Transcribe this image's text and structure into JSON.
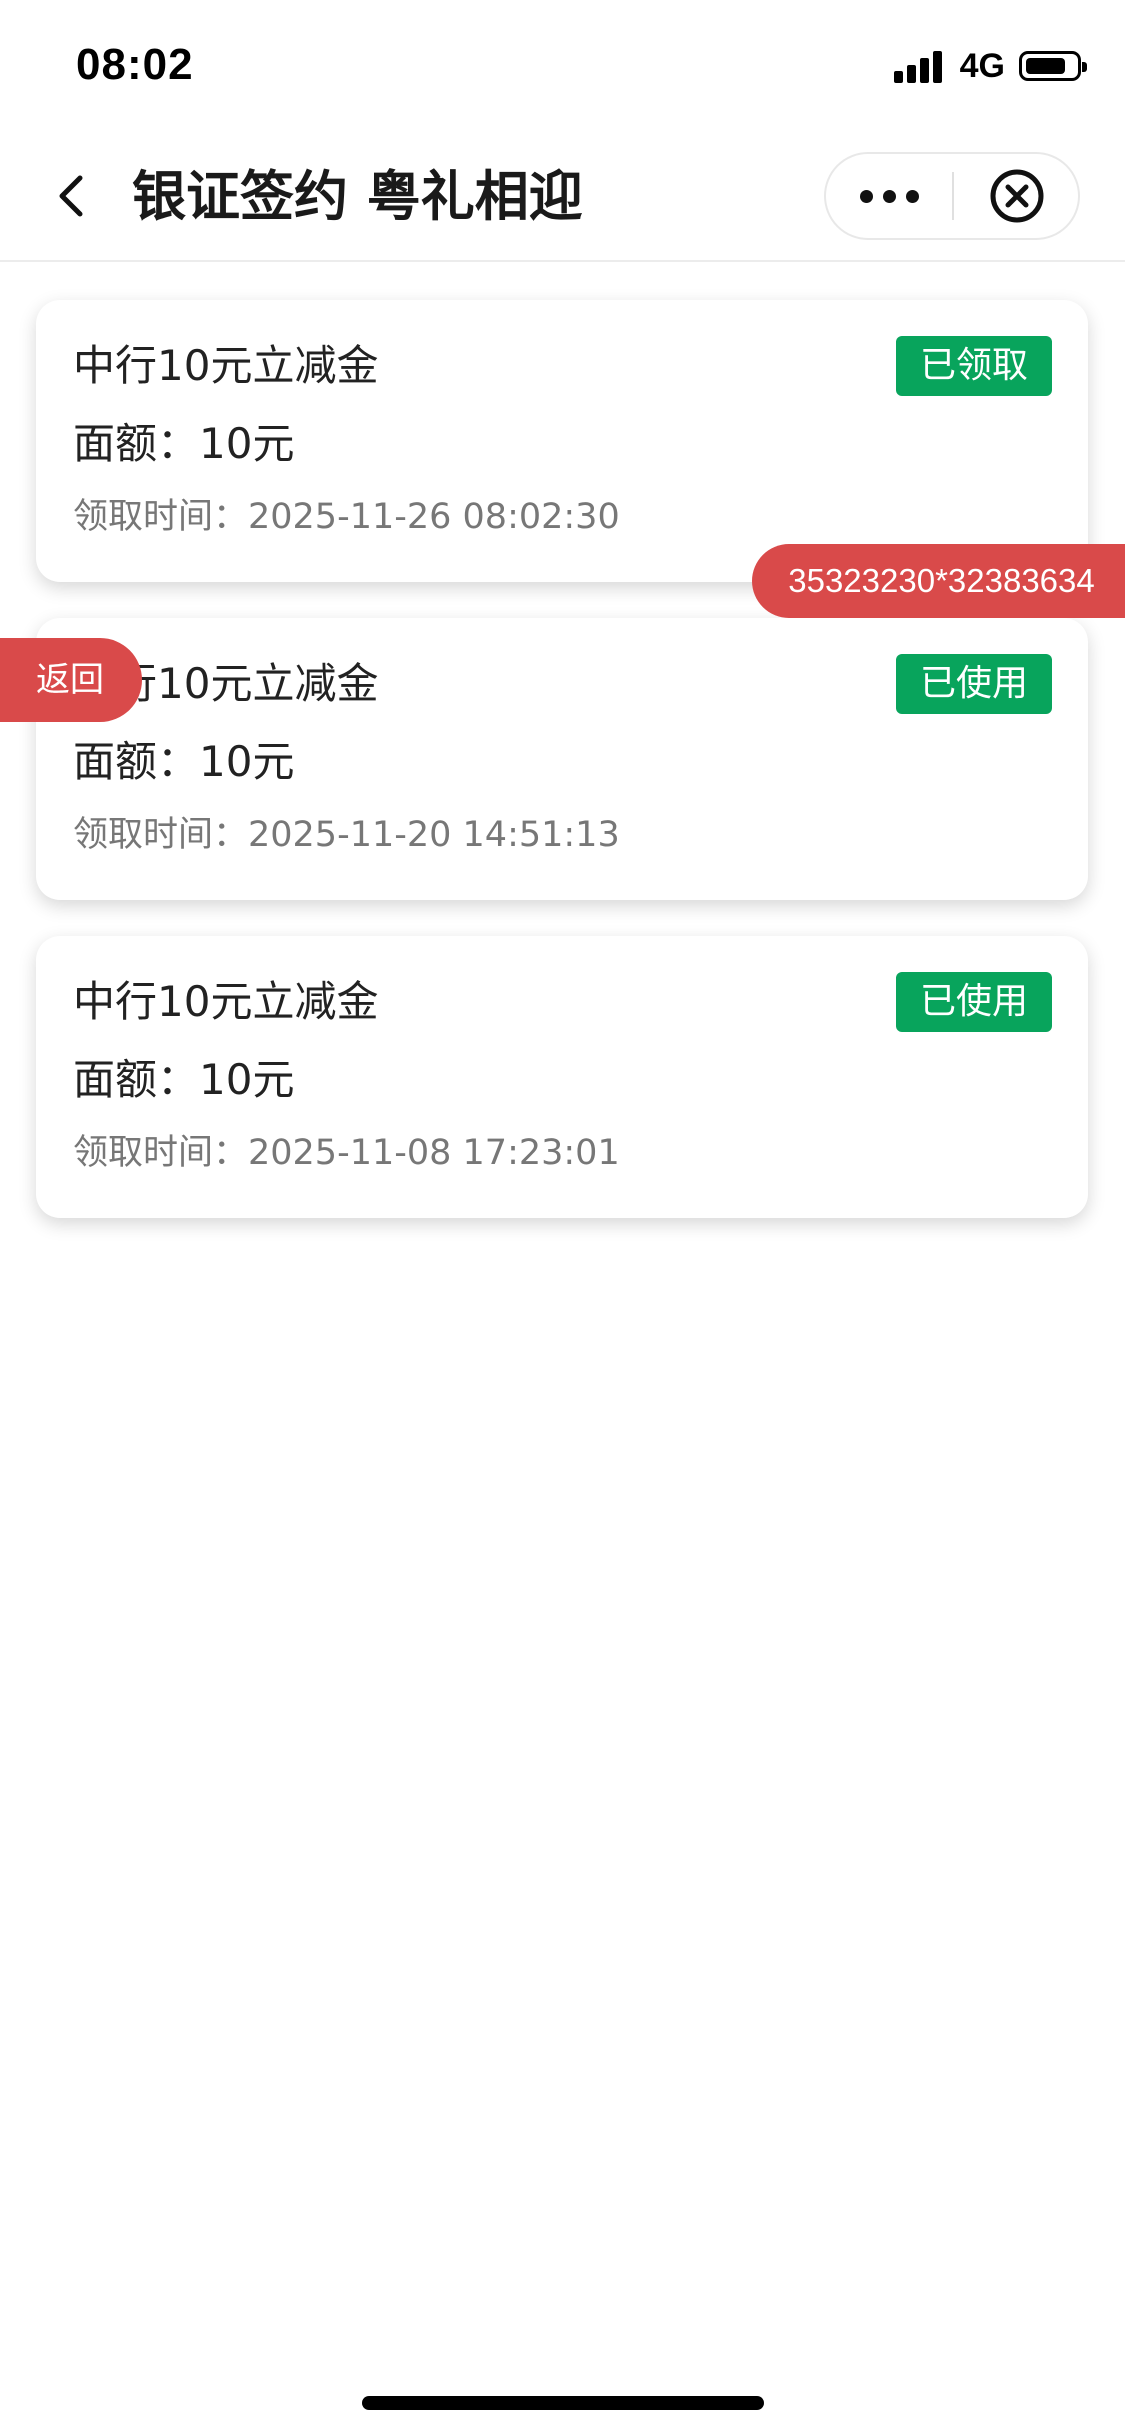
{
  "status_bar": {
    "time": "08:02",
    "network": "4G",
    "signal_icon": "cellular-signal-icon",
    "battery_icon": "battery-icon",
    "battery_level": 0.82
  },
  "nav": {
    "title": "银证签约 粤礼相迎",
    "back_icon": "chevron-left-icon",
    "more_icon": "more-dots-icon",
    "close_icon": "circle-close-icon"
  },
  "cards": [
    {
      "title": "中行10元立减金",
      "amount": "面额：10元",
      "time": "领取时间：2025-11-26 08:02:30",
      "status": "已领取"
    },
    {
      "title": "中行10元立减金",
      "amount": "面额：10元",
      "time": "领取时间：2025-11-20 14:51:13",
      "status": "已使用"
    },
    {
      "title": "中行10元立减金",
      "amount": "面额：10元",
      "time": "领取时间：2025-11-08 17:23:01",
      "status": "已使用"
    }
  ],
  "overlays": {
    "back_button": "返回",
    "code_tag": "35323230*32383634"
  },
  "colors": {
    "badge_green": "#08a45c",
    "overlay_red": "#d94a4a"
  }
}
